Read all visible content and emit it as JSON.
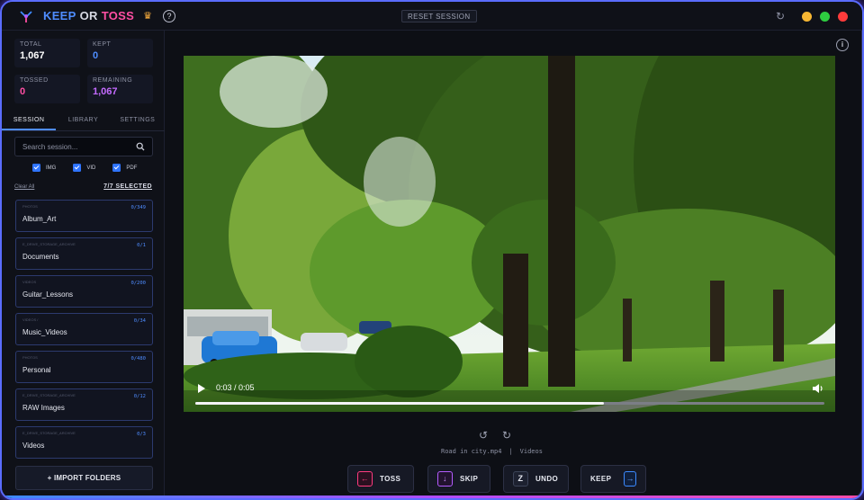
{
  "app": {
    "brand_keep": "KEEP",
    "brand_or": "OR",
    "brand_toss": "TOSS",
    "reset_label": "RESET SESSION",
    "help_label": "?",
    "window_dots": [
      "#f7b733",
      "#2ecc40",
      "#ff3b3b"
    ]
  },
  "stats": {
    "total_label": "TOTAL",
    "total_value": "1,067",
    "kept_label": "KEPT",
    "kept_value": "0",
    "tossed_label": "TOSSED",
    "tossed_value": "0",
    "remaining_label": "REMAINING",
    "remaining_value": "1,067"
  },
  "tabs": [
    "SESSION",
    "LIBRARY",
    "SETTINGS"
  ],
  "search": {
    "placeholder": "Search session..."
  },
  "filters": [
    "IMG",
    "VID",
    "PDF"
  ],
  "clear_all": "Clear All",
  "selected": "7/7 SELECTED",
  "folders": [
    {
      "path": "PHOTOS",
      "name": "Album_Art",
      "count": "0/349"
    },
    {
      "path": "E_DRIVE_STORAGE_ARCHIVE",
      "name": "Documents",
      "count": "0/1"
    },
    {
      "path": "VIDEOS",
      "name": "Guitar_Lessons",
      "count": "0/200"
    },
    {
      "path": "VIDEOS /",
      "name": "Music_Videos",
      "count": "0/34"
    },
    {
      "path": "PHOTOS",
      "name": "Personal",
      "count": "0/480"
    },
    {
      "path": "E_DRIVE_STORAGE_ARCHIVE",
      "name": "RAW Images",
      "count": "0/12"
    },
    {
      "path": "E_DRIVE_STORAGE_ARCHIVE",
      "name": "Videos",
      "count": "0/3"
    }
  ],
  "import_label": "+ IMPORT FOLDERS",
  "player": {
    "time": "0:03 / 0:05",
    "progress": 0.65,
    "filename": "Road in city.mp4",
    "separator": "|",
    "folder": "Videos"
  },
  "actions": {
    "toss_label": "TOSS",
    "toss_key": "←",
    "toss_color": "#ff3b7f",
    "skip_label": "SKIP",
    "skip_key": "↓",
    "skip_color": "#b45cff",
    "undo_label": "UNDO",
    "undo_key": "Z",
    "undo_color": "#3d8bff",
    "keep_label": "KEEP",
    "keep_key": "→",
    "keep_color": "#3d8bff"
  }
}
